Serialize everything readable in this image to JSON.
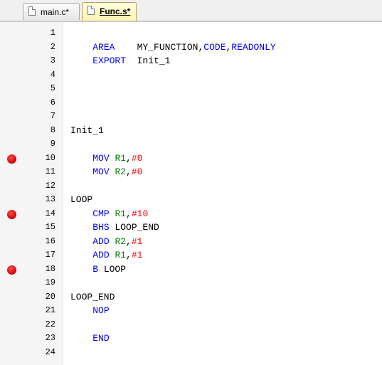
{
  "tabs": [
    {
      "label": "main.c*",
      "active": false
    },
    {
      "label": "Func.s*",
      "active": true
    }
  ],
  "colors": {
    "keyword": "#0000ff",
    "register": "#008000",
    "number": "#ff0000",
    "breakpoint": "#e00000"
  },
  "lines": [
    {
      "num": "1",
      "breakpoint": false,
      "tokens": []
    },
    {
      "num": "2",
      "breakpoint": false,
      "tokens": [
        {
          "t": "    "
        },
        {
          "t": "AREA",
          "c": "kw"
        },
        {
          "t": "    MY_FUNCTION,",
          "c": "id"
        },
        {
          "t": "CODE",
          "c": "kw"
        },
        {
          "t": ",",
          "c": "id"
        },
        {
          "t": "READONLY",
          "c": "kw"
        }
      ]
    },
    {
      "num": "3",
      "breakpoint": false,
      "tokens": [
        {
          "t": "    "
        },
        {
          "t": "EXPORT",
          "c": "kw"
        },
        {
          "t": "  Init_1",
          "c": "id"
        }
      ]
    },
    {
      "num": "4",
      "breakpoint": false,
      "tokens": []
    },
    {
      "num": "5",
      "breakpoint": false,
      "tokens": []
    },
    {
      "num": "6",
      "breakpoint": false,
      "tokens": []
    },
    {
      "num": "7",
      "breakpoint": false,
      "tokens": []
    },
    {
      "num": "8",
      "breakpoint": false,
      "tokens": [
        {
          "t": "Init_1",
          "c": "id"
        }
      ]
    },
    {
      "num": "9",
      "breakpoint": false,
      "tokens": []
    },
    {
      "num": "10",
      "breakpoint": true,
      "tokens": [
        {
          "t": "    "
        },
        {
          "t": "MOV",
          "c": "kw"
        },
        {
          "t": " "
        },
        {
          "t": "R1",
          "c": "reg"
        },
        {
          "t": ",",
          "c": "id"
        },
        {
          "t": "#0",
          "c": "num"
        }
      ]
    },
    {
      "num": "11",
      "breakpoint": false,
      "tokens": [
        {
          "t": "    "
        },
        {
          "t": "MOV",
          "c": "kw"
        },
        {
          "t": " "
        },
        {
          "t": "R2",
          "c": "reg"
        },
        {
          "t": ",",
          "c": "id"
        },
        {
          "t": "#0",
          "c": "num"
        }
      ]
    },
    {
      "num": "12",
      "breakpoint": false,
      "tokens": []
    },
    {
      "num": "13",
      "breakpoint": false,
      "tokens": [
        {
          "t": "LOOP",
          "c": "id"
        }
      ]
    },
    {
      "num": "14",
      "breakpoint": true,
      "tokens": [
        {
          "t": "    "
        },
        {
          "t": "CMP",
          "c": "kw"
        },
        {
          "t": " "
        },
        {
          "t": "R1",
          "c": "reg"
        },
        {
          "t": ",",
          "c": "id"
        },
        {
          "t": "#10",
          "c": "num"
        }
      ]
    },
    {
      "num": "15",
      "breakpoint": false,
      "tokens": [
        {
          "t": "    "
        },
        {
          "t": "BHS",
          "c": "kw"
        },
        {
          "t": " LOOP_END",
          "c": "id"
        }
      ]
    },
    {
      "num": "16",
      "breakpoint": false,
      "tokens": [
        {
          "t": "    "
        },
        {
          "t": "ADD",
          "c": "kw"
        },
        {
          "t": " "
        },
        {
          "t": "R2",
          "c": "reg"
        },
        {
          "t": ",",
          "c": "id"
        },
        {
          "t": "#1",
          "c": "num"
        }
      ]
    },
    {
      "num": "17",
      "breakpoint": false,
      "tokens": [
        {
          "t": "    "
        },
        {
          "t": "ADD",
          "c": "kw"
        },
        {
          "t": " "
        },
        {
          "t": "R1",
          "c": "reg"
        },
        {
          "t": ",",
          "c": "id"
        },
        {
          "t": "#1",
          "c": "num"
        }
      ]
    },
    {
      "num": "18",
      "breakpoint": true,
      "tokens": [
        {
          "t": "    "
        },
        {
          "t": "B",
          "c": "kw"
        },
        {
          "t": " LOOP",
          "c": "id"
        }
      ]
    },
    {
      "num": "19",
      "breakpoint": false,
      "tokens": []
    },
    {
      "num": "20",
      "breakpoint": false,
      "tokens": [
        {
          "t": "LOOP_END",
          "c": "id"
        }
      ]
    },
    {
      "num": "21",
      "breakpoint": false,
      "tokens": [
        {
          "t": "    "
        },
        {
          "t": "NOP",
          "c": "kw"
        }
      ]
    },
    {
      "num": "22",
      "breakpoint": false,
      "tokens": []
    },
    {
      "num": "23",
      "breakpoint": false,
      "tokens": [
        {
          "t": "    "
        },
        {
          "t": "END",
          "c": "kw"
        }
      ]
    },
    {
      "num": "24",
      "breakpoint": false,
      "tokens": []
    }
  ]
}
